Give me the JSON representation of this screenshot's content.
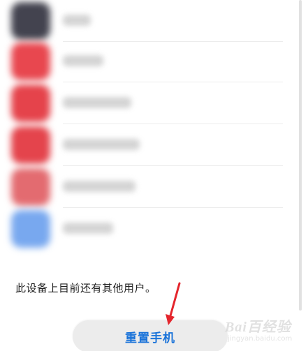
{
  "apps": [
    {
      "icon": "dark-app-icon",
      "color": "#43434f"
    },
    {
      "icon": "red-app-icon",
      "color": "#e8474f"
    },
    {
      "icon": "red-app-icon",
      "color": "#e5434b"
    },
    {
      "icon": "red-app-icon",
      "color": "#e4444c"
    },
    {
      "icon": "red-app-icon",
      "color": "#e36b70"
    },
    {
      "icon": "blue-app-icon",
      "color": "#78a8ef"
    }
  ],
  "notice_text": "此设备上目前还有其他用户。",
  "reset_button": {
    "label": "重置手机",
    "color": "#1a73d9"
  },
  "watermark": {
    "brand": "Bai百经验",
    "url": "jingyan.baidu.com"
  },
  "annotation": {
    "arrow_color": "#e4252c"
  }
}
